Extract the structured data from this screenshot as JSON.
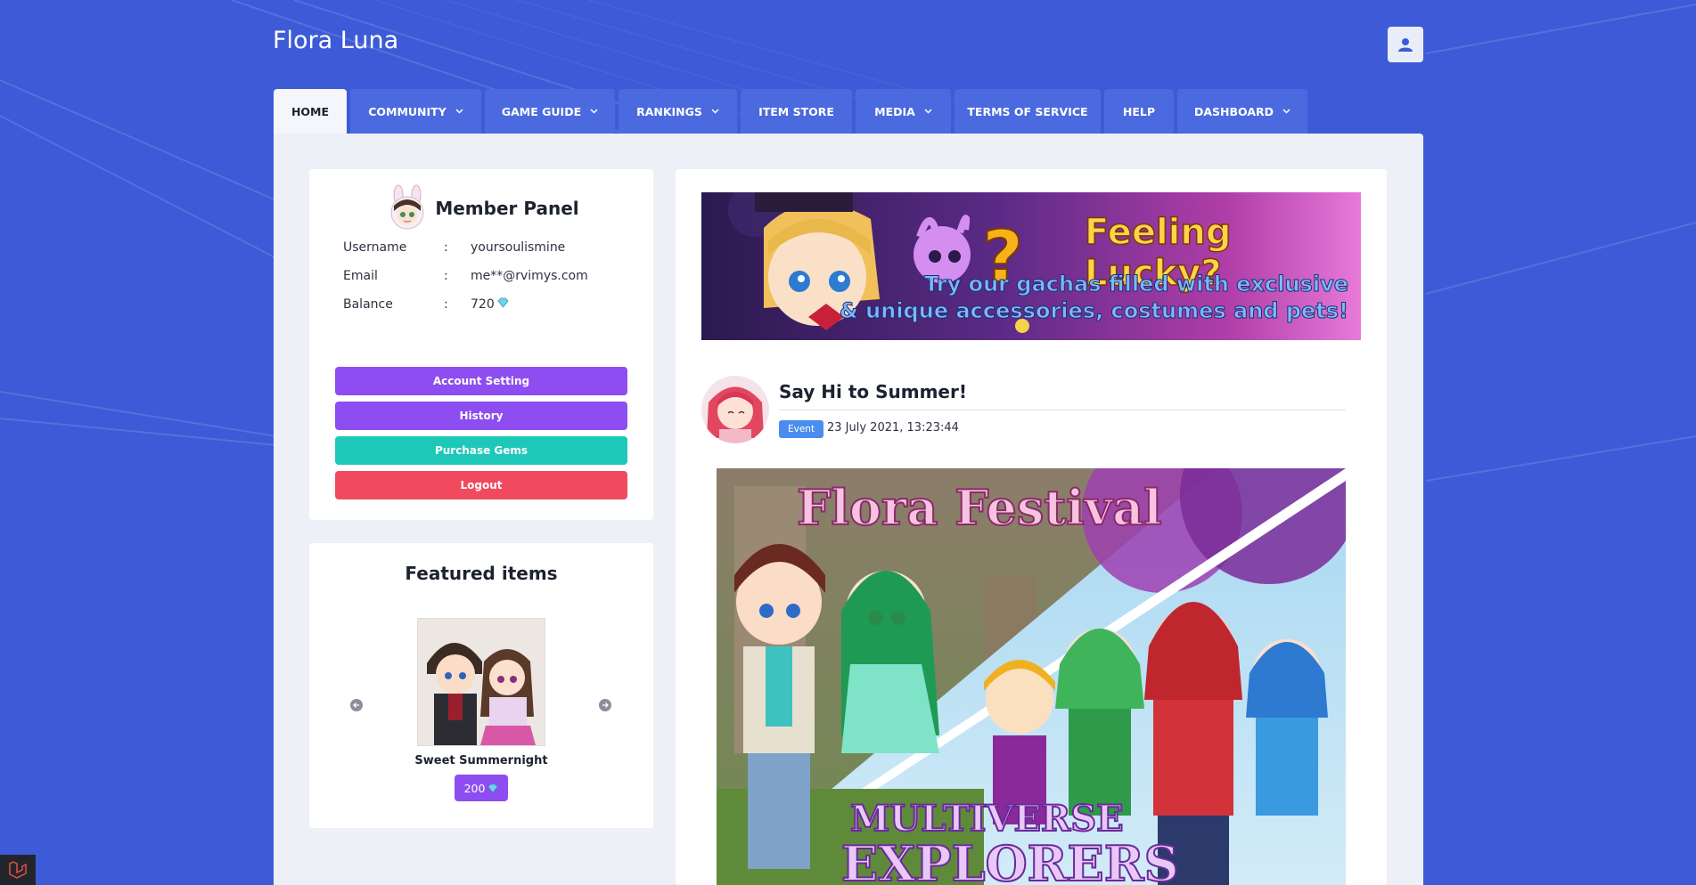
{
  "site": {
    "title": "Flora Luna"
  },
  "header": {
    "user_icon": "user-icon"
  },
  "nav": {
    "items": [
      {
        "label": "HOME",
        "active": true,
        "dropdown": false
      },
      {
        "label": "COMMUNITY",
        "active": false,
        "dropdown": true
      },
      {
        "label": "GAME GUIDE",
        "active": false,
        "dropdown": true
      },
      {
        "label": "RANKINGS",
        "active": false,
        "dropdown": true
      },
      {
        "label": "ITEM STORE",
        "active": false,
        "dropdown": false
      },
      {
        "label": "MEDIA",
        "active": false,
        "dropdown": true
      },
      {
        "label": "TERMS OF SERVICE",
        "active": false,
        "dropdown": false
      },
      {
        "label": "HELP",
        "active": false,
        "dropdown": false
      },
      {
        "label": "DASHBOARD",
        "active": false,
        "dropdown": true
      }
    ]
  },
  "member_panel": {
    "title": "Member Panel",
    "rows": [
      {
        "label": "Username",
        "colon": ":",
        "value": "yoursoulismine"
      },
      {
        "label": "Email",
        "colon": ":",
        "value": "me**@rvimys.com"
      },
      {
        "label": "Balance",
        "colon": ":",
        "value": "720",
        "icon": "gem-icon"
      }
    ],
    "buttons": [
      {
        "label": "Account Setting",
        "color": "#8d4df0"
      },
      {
        "label": "History",
        "color": "#8d4df0"
      },
      {
        "label": "Purchase Gems",
        "color": "#1dc8b8"
      },
      {
        "label": "Logout",
        "color": "#f14a5e"
      }
    ]
  },
  "featured": {
    "title": "Featured items",
    "item_name": "Sweet Summernight",
    "price": "200",
    "price_icon": "gem-icon"
  },
  "banner": {
    "headline": "Feeling Lucky?",
    "subline1": "Try our gachas filled with exclusive",
    "subline2": "& unique accessories, costumes and pets!"
  },
  "post": {
    "title": "Say Hi to Summer!",
    "badge": "Event",
    "date": "23 July 2021, 13:23:44",
    "image_title": "Flora Festival",
    "image_subtitle1": "Multiverse",
    "image_subtitle2": "Explorers"
  },
  "colors": {
    "background": "#3d5bd6",
    "nav_tab": "#4b6ae0",
    "purple": "#8d4df0",
    "teal": "#1dc8b8",
    "red": "#f14a5e",
    "badge_blue": "#4a8df0"
  }
}
